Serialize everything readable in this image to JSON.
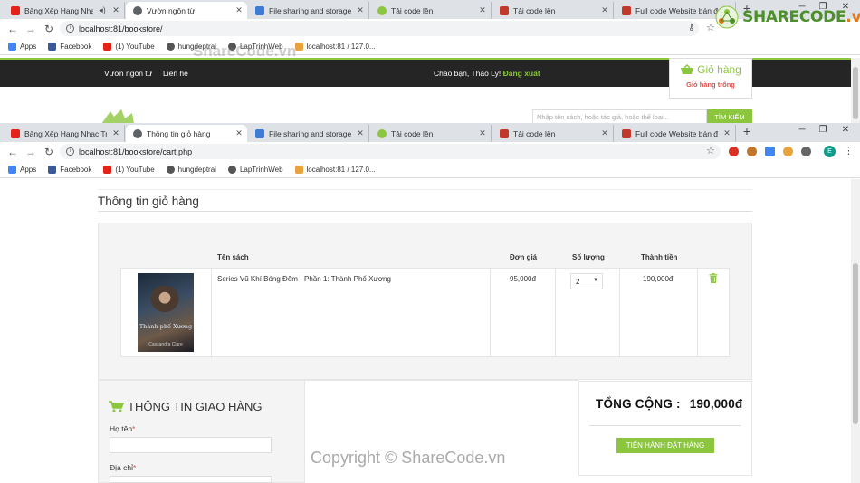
{
  "browser1": {
    "tabs": [
      {
        "title": "Bảng Xếp Hạng Nhạc Trẻ",
        "favicon_color": "#e62117",
        "active": false
      },
      {
        "title": "Vườn ngôn từ",
        "favicon_color": "#5f6368",
        "active": true
      },
      {
        "title": "File sharing and storage made",
        "favicon_color": "#3d7bd9",
        "active": false
      },
      {
        "title": "Tải code lên",
        "favicon_color": "#8cc63f",
        "active": false
      },
      {
        "title": "Tải code lên",
        "favicon_color": "#c0392b",
        "active": false
      },
      {
        "title": "Full code Website bán đồ thể",
        "favicon_color": "#c0392b",
        "active": false
      }
    ],
    "url": "localhost:81/bookstore/"
  },
  "browser2": {
    "tabs": [
      {
        "title": "Bảng Xếp Hạng Nhạc Trẻ",
        "favicon_color": "#e62117",
        "active": false
      },
      {
        "title": "Thông tin giỏ hàng",
        "favicon_color": "#5f6368",
        "active": true
      },
      {
        "title": "File sharing and storage made",
        "favicon_color": "#3d7bd9",
        "active": false
      },
      {
        "title": "Tải code lên",
        "favicon_color": "#8cc63f",
        "active": false
      },
      {
        "title": "Tải code lên",
        "favicon_color": "#c0392b",
        "active": false
      },
      {
        "title": "Full code Website bán đồ thể",
        "favicon_color": "#c0392b",
        "active": false
      }
    ],
    "url": "localhost:81/bookstore/cart.php"
  },
  "bookmarks": [
    {
      "label": "Apps",
      "color": "#4285f4"
    },
    {
      "label": "Facebook",
      "color": "#3b5998"
    },
    {
      "label": "(1) YouTube",
      "color": "#e62117"
    },
    {
      "label": "hungdeptrai",
      "color": "#555555"
    },
    {
      "label": "LapTrinhWeb",
      "color": "#555555"
    },
    {
      "label": "localhost:81 / 127.0...",
      "color": "#e8a33d"
    }
  ],
  "bgsite": {
    "nav": [
      "Vườn ngôn từ",
      "Liên hệ"
    ],
    "greeting": "Chào bạn, Thảo Ly!",
    "logout": "Đăng xuất",
    "cart_title": "Giỏ hàng",
    "cart_status": "Giỏ hàng trống",
    "search_placeholder": "Nhập tên sách, hoặc tác giả, hoặc thể loại...",
    "search_button": "TÌM KIẾM"
  },
  "cart": {
    "heading": "Thông tin giỏ hàng",
    "columns": {
      "name": "Tên sách",
      "price": "Đơn giá",
      "qty": "Số lượng",
      "total": "Thành tiền"
    },
    "items": [
      {
        "name": "Series Vũ Khí Bóng Đêm - Phần 1: Thành Phố Xương",
        "price": "95,000đ",
        "qty": "2",
        "line_total": "190,000đ",
        "cover_title": "Thành phố Xương",
        "cover_author": "Cassandra Clare"
      }
    ]
  },
  "shipping": {
    "heading": "THÔNG TIN GIAO HÀNG",
    "fields": [
      {
        "label": "Họ tên",
        "required": "*"
      },
      {
        "label": "Địa chỉ",
        "required": "*"
      }
    ]
  },
  "summary": {
    "total_label": "TỔNG CỘNG :",
    "total_value": "190,000đ",
    "order_button": "TIẾN HÀNH ĐẶT HÀNG"
  },
  "watermarks": {
    "logo_main": "SHARE",
    "logo_accent": "CODE",
    "logo_suffix": ".vn",
    "center": "ShareCode.vn",
    "bottom": "Copyright © ShareCode.vn"
  },
  "colors": {
    "accent": "#8cc63f",
    "nav_bg": "#252525",
    "danger": "#d9534f"
  }
}
